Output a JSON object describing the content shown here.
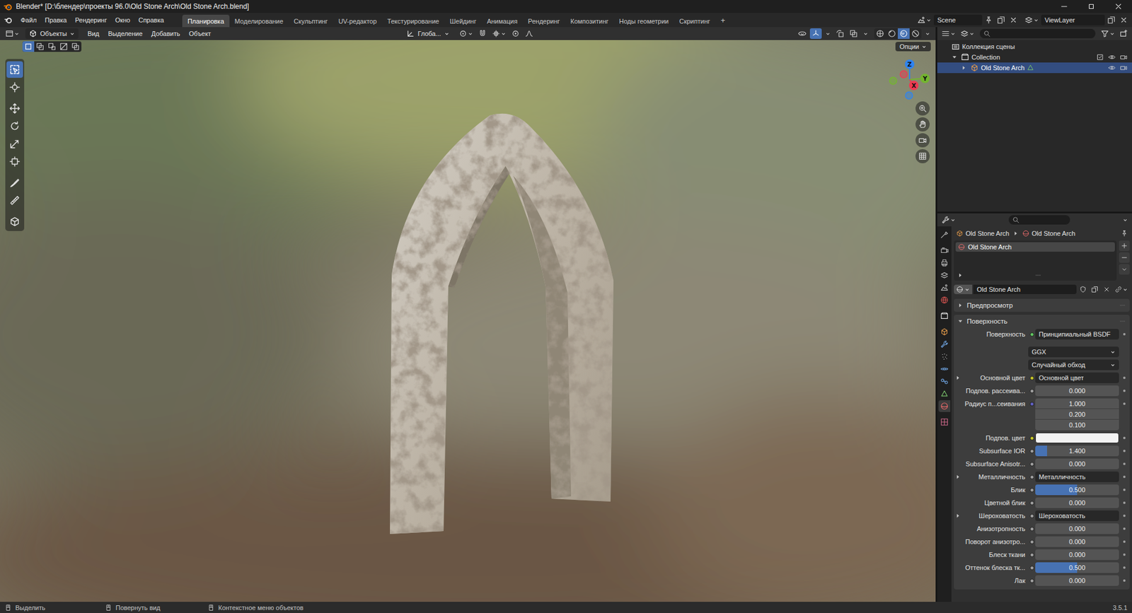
{
  "window": {
    "title": "Blender* [D:\\блендер\\проекты 96.0\\Old Stone Arch\\Old Stone Arch.blend]"
  },
  "menu": [
    "Файл",
    "Правка",
    "Рендеринг",
    "Окно",
    "Справка"
  ],
  "workspaces": [
    {
      "label": "Планировка",
      "selected": true
    },
    {
      "label": "Моделирование",
      "selected": false
    },
    {
      "label": "Скульптинг",
      "selected": false
    },
    {
      "label": "UV-редактор",
      "selected": false
    },
    {
      "label": "Текстурирование",
      "selected": false
    },
    {
      "label": "Шейдинг",
      "selected": false
    },
    {
      "label": "Анимация",
      "selected": false
    },
    {
      "label": "Рендеринг",
      "selected": false
    },
    {
      "label": "Композитинг",
      "selected": false
    },
    {
      "label": "Ноды геометрии",
      "selected": false
    },
    {
      "label": "Скриптинг",
      "selected": false
    }
  ],
  "add_workspace": "+",
  "scene": "Scene",
  "view_layer": "ViewLayer",
  "viewport": {
    "mode": "Объекты",
    "menus": [
      "Вид",
      "Выделение",
      "Добавить",
      "Объект"
    ],
    "orientation": "Глоба...",
    "options": "Опции",
    "select_modes": [
      {
        "selected": true
      },
      {
        "selected": false
      },
      {
        "selected": false
      },
      {
        "selected": false
      },
      {
        "selected": false
      }
    ],
    "header_toggles": [
      {
        "selected": false
      },
      {
        "selected": true
      },
      {
        "selected": false
      },
      {
        "selected": false
      }
    ],
    "shading": [
      {
        "selected": false
      },
      {
        "selected": false
      },
      {
        "selected": true
      },
      {
        "selected": false
      }
    ],
    "tools": [
      {
        "selected": true
      },
      {
        "selected": false
      },
      {
        "selected": false
      },
      {
        "selected": false
      },
      {
        "selected": false
      },
      {
        "selected": false
      },
      {
        "selected": false
      },
      {
        "selected": false
      },
      {
        "selected": false
      }
    ],
    "gizmo": [
      {
        "label": "Z",
        "color": "#2f84f0"
      },
      {
        "label": "Y",
        "color": "#74b530"
      },
      {
        "label": "X",
        "color": "#ee3a52"
      }
    ]
  },
  "outliner": {
    "items": [
      {
        "label": "Коллекция сцены",
        "depth": 0,
        "kind": "scene",
        "selected": false
      },
      {
        "label": "Collection",
        "depth": 1,
        "kind": "collection",
        "expanded": true,
        "selected": false,
        "checked": true,
        "visible": true,
        "renderable": true
      },
      {
        "label": "Old Stone Arch",
        "depth": 2,
        "kind": "object",
        "expanded": false,
        "selected": true,
        "visible": true,
        "renderable": true
      }
    ]
  },
  "properties": {
    "tabs": [
      {
        "selected": false
      },
      {
        "selected": false
      },
      {
        "selected": false
      },
      {
        "selected": false
      },
      {
        "selected": false
      },
      {
        "selected": false
      },
      {
        "selected": false
      },
      {
        "selected": false
      },
      {
        "selected": false
      },
      {
        "selected": false
      },
      {
        "selected": false
      },
      {
        "selected": false
      },
      {
        "selected": false
      },
      {
        "selected": true
      },
      {
        "selected": false
      }
    ],
    "breadcrumb": [
      "Old Stone Arch",
      "Old Stone Arch"
    ],
    "slots": [
      {
        "label": "Old Stone Arch",
        "selected": true
      }
    ],
    "material": "Old Stone Arch",
    "panels": [
      {
        "label": "Предпросмотр",
        "expanded": false
      },
      {
        "label": "Поверхность",
        "expanded": true
      }
    ],
    "rows": [
      {
        "kind": "link",
        "label": "Поверхность",
        "value": "Принципиальный BSDF",
        "color": "#63c763"
      },
      {
        "kind": "dropdown",
        "value": "GGX"
      },
      {
        "kind": "dropdown",
        "value": "Случайный обход"
      },
      {
        "kind": "link",
        "label": "Основной цвет",
        "value": "Основной цвет",
        "color": "#c7c729",
        "expanded": false
      },
      {
        "kind": "number",
        "label": "Подпов. рассеива...",
        "value": "0.000",
        "level": 0,
        "color": "#a1a1a1"
      },
      {
        "kind": "vector",
        "label": "Радиус п...сеивания",
        "values": [
          "1.000",
          "0.200",
          "0.100"
        ],
        "color": "#6363c7"
      },
      {
        "kind": "color",
        "label": "Подпов. цвет",
        "swatch": "#f2f2f2",
        "color": "#c7c729"
      },
      {
        "kind": "number",
        "label": "Subsurface IOR",
        "value": "1.400",
        "level": 0.14,
        "color": "#a1a1a1"
      },
      {
        "kind": "number",
        "label": "Subsurface Anisotr...",
        "value": "0.000",
        "level": 0,
        "color": "#a1a1a1"
      },
      {
        "kind": "link",
        "label": "Металличность",
        "value": "Металличность",
        "color": "#a1a1a1",
        "expanded": false
      },
      {
        "kind": "number",
        "label": "Блик",
        "value": "0.500",
        "level": 0.5,
        "color": "#a1a1a1"
      },
      {
        "kind": "number",
        "label": "Цветной блик",
        "value": "0.000",
        "level": 0,
        "color": "#a1a1a1"
      },
      {
        "kind": "link",
        "label": "Шероховатость",
        "value": "Шероховатость",
        "color": "#a1a1a1",
        "expanded": false
      },
      {
        "kind": "number",
        "label": "Анизотропность",
        "value": "0.000",
        "level": 0,
        "color": "#a1a1a1"
      },
      {
        "kind": "number",
        "label": "Поворот анизотро...",
        "value": "0.000",
        "level": 0,
        "color": "#a1a1a1"
      },
      {
        "kind": "number",
        "label": "Блеск ткани",
        "value": "0.000",
        "level": 0,
        "color": "#a1a1a1"
      },
      {
        "kind": "number",
        "label": "Оттенок блеска тк...",
        "value": "0.500",
        "level": 0.5,
        "color": "#a1a1a1"
      },
      {
        "kind": "number",
        "label": "Лак",
        "value": "0.000",
        "level": 0,
        "color": "#a1a1a1"
      }
    ]
  },
  "status_bar": {
    "items": [
      "Выделить",
      "Повернуть вид",
      "Контекстное меню объектов"
    ],
    "version": "3.5.1"
  }
}
